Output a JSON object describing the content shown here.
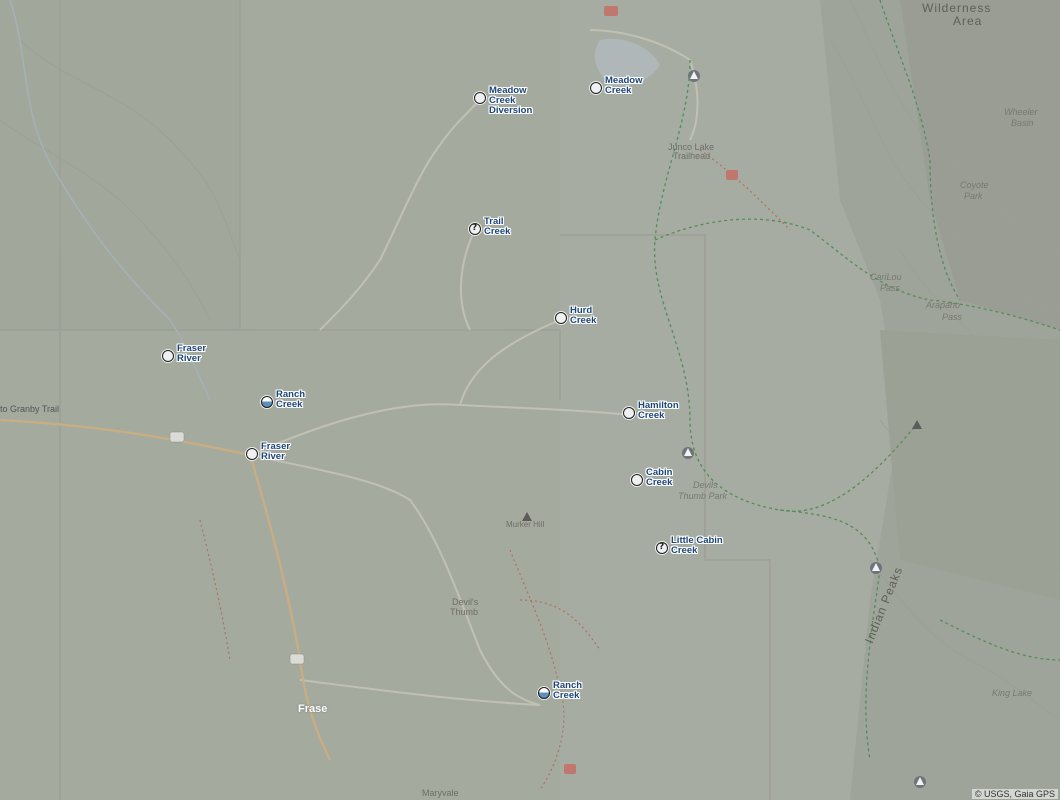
{
  "map": {
    "attribution": "© USGS, Gaia GPS",
    "places": [
      {
        "id": "wilderness",
        "text": "Wilderness",
        "style": "big"
      },
      {
        "id": "area",
        "text": "Area",
        "style": "big"
      },
      {
        "id": "junco-lake",
        "text": "Junco Lake",
        "style": "plain"
      },
      {
        "id": "trailhead",
        "text": "Trailhead",
        "style": "plain"
      },
      {
        "id": "wheeler",
        "text": "Wheeler",
        "style": "italic"
      },
      {
        "id": "basin",
        "text": "Basin",
        "style": "italic"
      },
      {
        "id": "coyote",
        "text": "Coyote",
        "style": "italic"
      },
      {
        "id": "park",
        "text": "Park",
        "style": "italic"
      },
      {
        "id": "caribou",
        "text": "CariLou",
        "style": "italic"
      },
      {
        "id": "pass1",
        "text": "Pass",
        "style": "italic"
      },
      {
        "id": "arapaho",
        "text": "Arapaho",
        "style": "italic"
      },
      {
        "id": "pass2",
        "text": "Pass",
        "style": "italic"
      },
      {
        "id": "devils-thumb-park-1",
        "text": "Devils",
        "style": "italic"
      },
      {
        "id": "devils-thumb-park-2",
        "text": "Thumb Park",
        "style": "italic"
      },
      {
        "id": "mosquito",
        "text": "Murker Hill",
        "style": "plain"
      },
      {
        "id": "devils-thumb-1",
        "text": "Devil's",
        "style": "plain"
      },
      {
        "id": "devils-thumb-2",
        "text": "Thumb",
        "style": "plain"
      },
      {
        "id": "granby-trail",
        "text": "to Granby Trail",
        "style": "plain"
      },
      {
        "id": "fraser-town",
        "text": "Frase",
        "style": "white"
      },
      {
        "id": "maryvale",
        "text": "Maryvale",
        "style": "plain"
      },
      {
        "id": "king-lake",
        "text": "King Lake",
        "style": "italic"
      },
      {
        "id": "indian-peaks",
        "text": "Indian Peaks",
        "style": "big"
      }
    ],
    "gauges": [
      {
        "id": "meadow-creek-diversion",
        "lines": [
          "Meadow",
          "Creek",
          "Diversion"
        ],
        "marker": "white"
      },
      {
        "id": "meadow-creek",
        "lines": [
          "Meadow",
          "Creek"
        ],
        "marker": "white"
      },
      {
        "id": "trail-creek",
        "lines": [
          "Trail",
          "Creek"
        ],
        "marker": "unknown"
      },
      {
        "id": "hurd-creek",
        "lines": [
          "Hurd",
          "Creek"
        ],
        "marker": "white"
      },
      {
        "id": "fraser-river-1",
        "lines": [
          "Fraser",
          "River"
        ],
        "marker": "white"
      },
      {
        "id": "ranch-creek-1",
        "lines": [
          "Ranch",
          "Creek"
        ],
        "marker": "blue"
      },
      {
        "id": "fraser-river-2",
        "lines": [
          "Fraser",
          "River"
        ],
        "marker": "white"
      },
      {
        "id": "hamilton-creek",
        "lines": [
          "Hamilton",
          "Creek"
        ],
        "marker": "white"
      },
      {
        "id": "cabin-creek",
        "lines": [
          "Cabin",
          "Creek"
        ],
        "marker": "white"
      },
      {
        "id": "little-cabin-creek",
        "lines": [
          "Little Cabin",
          "Creek"
        ],
        "marker": "unknown"
      },
      {
        "id": "ranch-creek-2",
        "lines": [
          "Ranch",
          "Creek"
        ],
        "marker": "blue"
      }
    ]
  }
}
